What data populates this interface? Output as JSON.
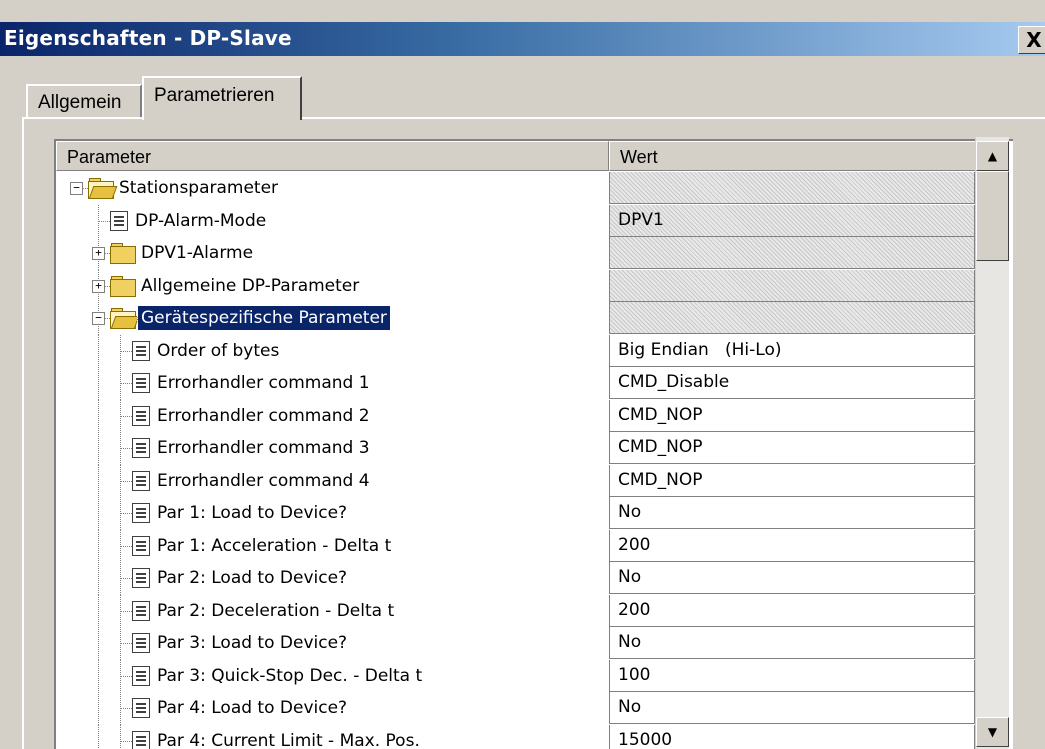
{
  "window": {
    "title": "Eigenschaften - DP-Slave",
    "close_label": "X"
  },
  "tabs": [
    {
      "label": "Allgemein",
      "active": false
    },
    {
      "label": "Parametrieren",
      "active": true
    }
  ],
  "table": {
    "columns": [
      "Parameter",
      "Wert"
    ],
    "rows": [
      {
        "label": "Stationsparameter",
        "value": "",
        "type": "folder",
        "level": 0,
        "expander": "minus",
        "open": true,
        "hatched": true,
        "selected": false
      },
      {
        "label": "DP-Alarm-Mode",
        "value": "DPV1",
        "type": "param",
        "level": 1,
        "expander": "",
        "open": false,
        "hatched": true,
        "selected": false
      },
      {
        "label": "DPV1-Alarme",
        "value": "",
        "type": "folder",
        "level": 1,
        "expander": "plus",
        "open": false,
        "hatched": true,
        "selected": false
      },
      {
        "label": "Allgemeine DP-Parameter",
        "value": "",
        "type": "folder",
        "level": 1,
        "expander": "plus",
        "open": false,
        "hatched": true,
        "selected": false
      },
      {
        "label": "Gerätespezifische Parameter",
        "value": "",
        "type": "folder",
        "level": 1,
        "expander": "minus",
        "open": true,
        "hatched": true,
        "selected": true
      },
      {
        "label": "Order of bytes",
        "value": "Big Endian   (Hi-Lo)",
        "type": "param",
        "level": 2,
        "expander": "",
        "open": false,
        "hatched": false,
        "selected": false
      },
      {
        "label": "Errorhandler command 1",
        "value": "CMD_Disable",
        "type": "param",
        "level": 2,
        "expander": "",
        "open": false,
        "hatched": false,
        "selected": false
      },
      {
        "label": "Errorhandler command 2",
        "value": "CMD_NOP",
        "type": "param",
        "level": 2,
        "expander": "",
        "open": false,
        "hatched": false,
        "selected": false
      },
      {
        "label": "Errorhandler command 3",
        "value": "CMD_NOP",
        "type": "param",
        "level": 2,
        "expander": "",
        "open": false,
        "hatched": false,
        "selected": false
      },
      {
        "label": "Errorhandler command 4",
        "value": "CMD_NOP",
        "type": "param",
        "level": 2,
        "expander": "",
        "open": false,
        "hatched": false,
        "selected": false
      },
      {
        "label": "Par 1: Load to Device?",
        "value": "No",
        "type": "param",
        "level": 2,
        "expander": "",
        "open": false,
        "hatched": false,
        "selected": false
      },
      {
        "label": "Par 1: Acceleration - Delta t",
        "value": "200",
        "type": "param",
        "level": 2,
        "expander": "",
        "open": false,
        "hatched": false,
        "selected": false
      },
      {
        "label": "Par 2: Load to Device?",
        "value": "No",
        "type": "param",
        "level": 2,
        "expander": "",
        "open": false,
        "hatched": false,
        "selected": false
      },
      {
        "label": "Par 2: Deceleration - Delta t",
        "value": "200",
        "type": "param",
        "level": 2,
        "expander": "",
        "open": false,
        "hatched": false,
        "selected": false
      },
      {
        "label": "Par 3: Load to Device?",
        "value": "No",
        "type": "param",
        "level": 2,
        "expander": "",
        "open": false,
        "hatched": false,
        "selected": false
      },
      {
        "label": "Par 3: Quick-Stop Dec. - Delta t",
        "value": "100",
        "type": "param",
        "level": 2,
        "expander": "",
        "open": false,
        "hatched": false,
        "selected": false
      },
      {
        "label": "Par 4: Load to Device?",
        "value": "No",
        "type": "param",
        "level": 2,
        "expander": "",
        "open": false,
        "hatched": false,
        "selected": false
      },
      {
        "label": "Par 4: Current Limit - Max. Pos.",
        "value": "15000",
        "type": "param",
        "level": 2,
        "expander": "",
        "open": false,
        "hatched": false,
        "selected": false
      }
    ]
  },
  "icons": {
    "folder_closed": "folder-icon",
    "folder_open": "folder-open-icon",
    "parameter": "parameter-icon",
    "scroll_up": "arrow-up-icon",
    "scroll_down": "arrow-down-icon",
    "close": "close-icon"
  },
  "colors": {
    "titlebar_start": "#0a246a",
    "titlebar_end": "#a6caf0",
    "selection": "#0a246a",
    "face": "#d4d0c8"
  }
}
